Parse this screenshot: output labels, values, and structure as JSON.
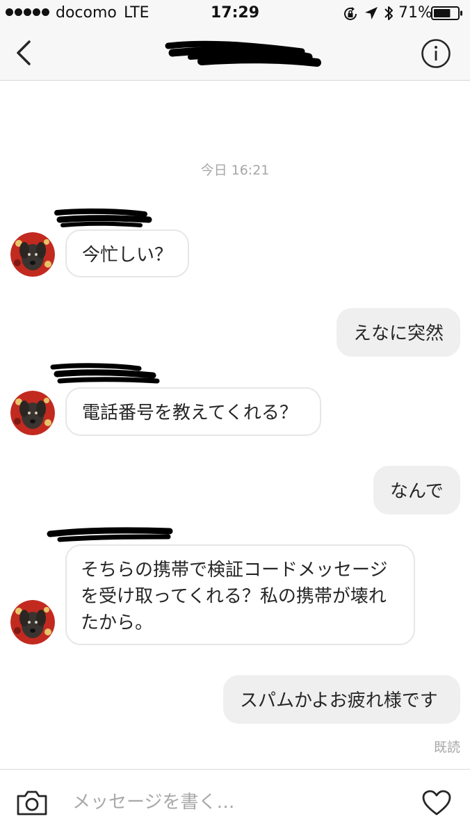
{
  "status_bar": {
    "signal_dots": 5,
    "carrier": "docomo",
    "network": "LTE",
    "time": "17:29",
    "icons": [
      "orientation-lock-icon",
      "location-arrow-icon",
      "bluetooth-icon",
      "battery-icon"
    ],
    "battery_percent": "71%",
    "battery_level": 0.71
  },
  "header": {
    "title_redacted": true,
    "back_icon": "chevron-left-icon",
    "info_icon": "info-icon"
  },
  "chat": {
    "timestamp": "今日 16:21",
    "messages": [
      {
        "direction": "incoming",
        "sender_redacted": true,
        "text": "今忙しい？"
      },
      {
        "direction": "outgoing",
        "text": "えなに突然"
      },
      {
        "direction": "incoming",
        "sender_redacted": true,
        "text": "電話番号を教えてくれる？"
      },
      {
        "direction": "outgoing",
        "text": "なんで"
      },
      {
        "direction": "incoming",
        "sender_redacted": true,
        "text": "そちらの携帯で検証コードメッセージを受け取ってくれる？私の携帯が壊れたから。"
      },
      {
        "direction": "outgoing",
        "text": "スパムかよお疲れ様です"
      }
    ],
    "read_receipt": "既読"
  },
  "composer": {
    "placeholder": "メッセージを書く…",
    "value": "",
    "camera_icon": "camera-icon",
    "heart_icon": "heart-icon"
  },
  "colors": {
    "bar_background": "#f7f7f7",
    "outgoing_bubble": "#efefef",
    "incoming_border": "#e6e6e6",
    "muted_text": "#a6a6a6",
    "text": "#262626"
  }
}
